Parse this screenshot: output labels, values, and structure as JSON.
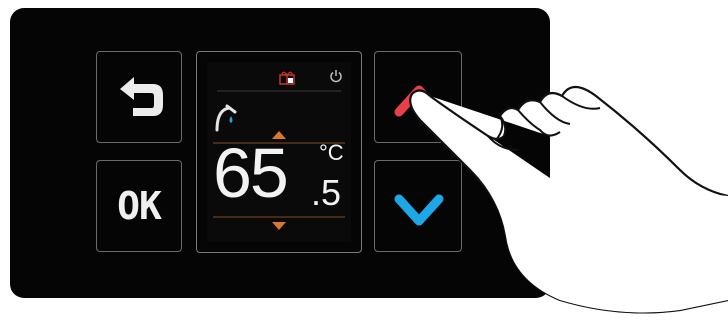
{
  "device": {
    "controls": {
      "back_icon": "return-arrow-icon",
      "ok_label": "OK",
      "up_icon": "chevron-up-icon",
      "down_icon": "chevron-down-icon"
    },
    "display": {
      "status_icons": [
        "gift-box-icon",
        "power-icon"
      ],
      "mode_icon": "shower-icon",
      "temperature": {
        "integer": "65",
        "decimal": ".5",
        "unit": "°C"
      }
    },
    "colors": {
      "up_accent": "#e8404a",
      "down_accent": "#1ea7e6",
      "adjust_arrows": "#d8782a",
      "status_icon": "#c0352e"
    }
  }
}
